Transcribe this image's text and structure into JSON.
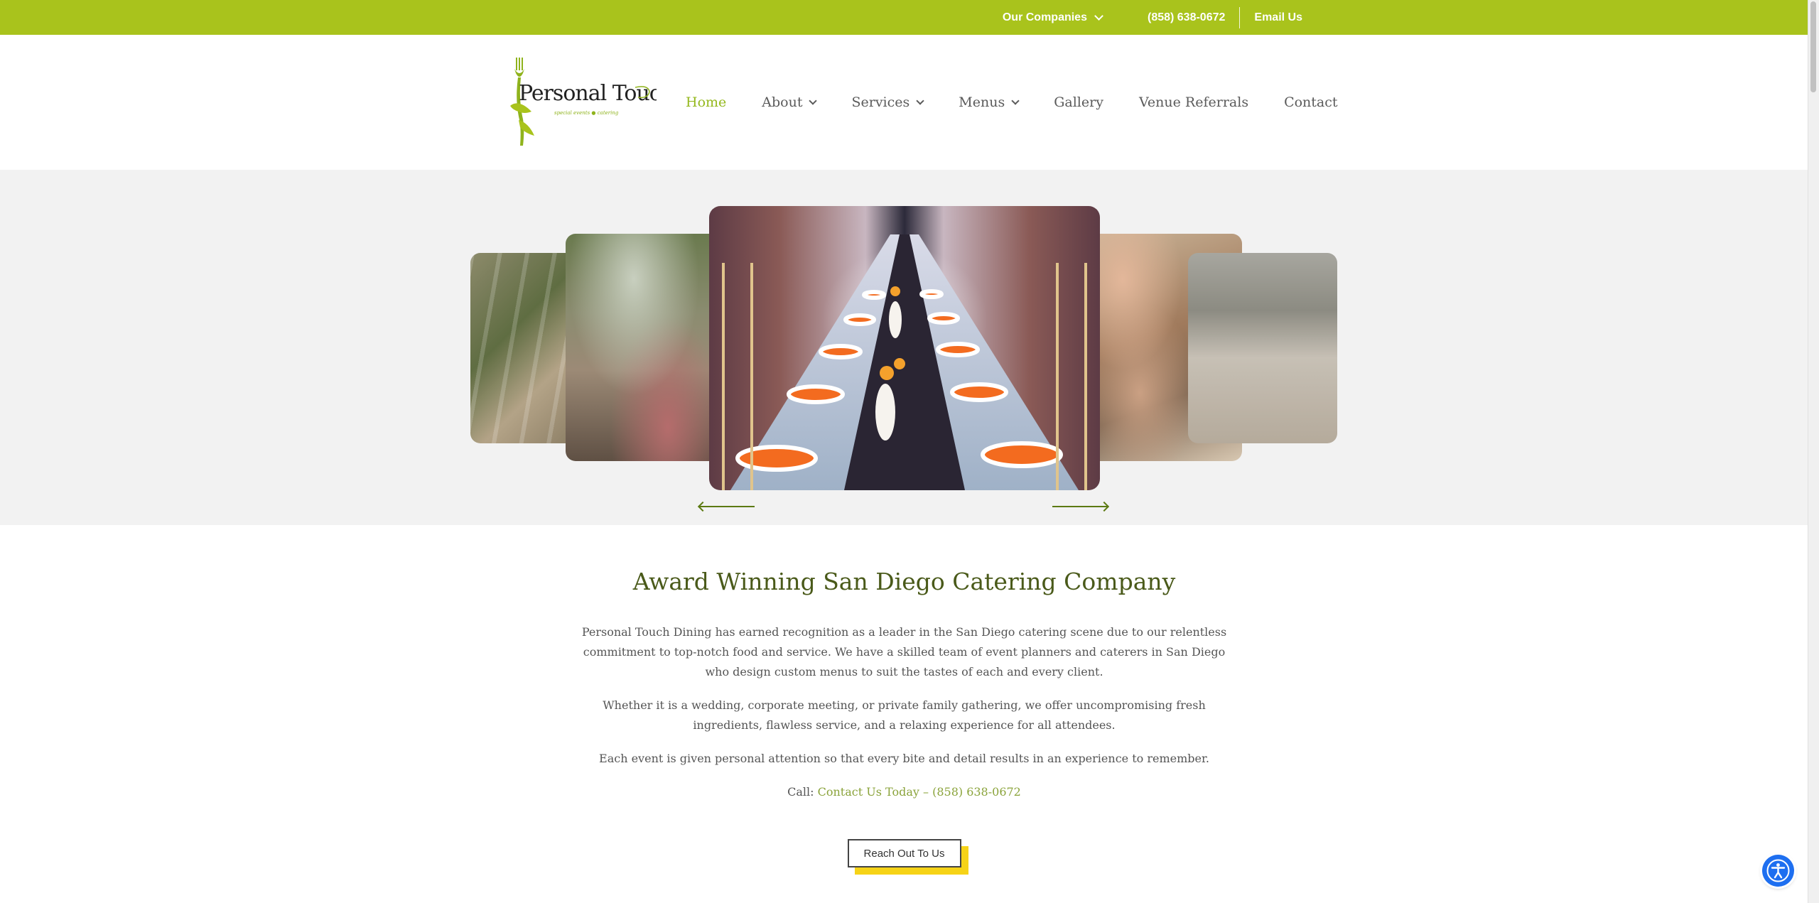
{
  "topbar": {
    "companies_label": "Our Companies",
    "phone": "(858) 638-0672",
    "email_label": "Email Us"
  },
  "header": {
    "logo_text": "Personal Touch dining",
    "logo_tagline": "special events ● catering"
  },
  "nav": {
    "items": [
      {
        "label": "Home"
      },
      {
        "label": "About"
      },
      {
        "label": "Services"
      },
      {
        "label": "Menus"
      },
      {
        "label": "Gallery"
      },
      {
        "label": "Venue Referrals"
      },
      {
        "label": "Contact"
      }
    ]
  },
  "main": {
    "heading": "Award Winning San Diego Catering Company",
    "paragraphs": [
      "Personal Touch Dining has earned recognition as a leader in the San Diego catering scene due to our relentless commitment to top-notch food and service. We have a skilled team of event planners and caterers in San Diego who design custom menus to suit the tastes of each and every client.",
      "Whether it is a wedding, corporate meeting, or private family gathering, we offer uncompromising fresh ingredients, flawless service, and a relaxing experience for all attendees.",
      "Each event is given personal attention so that every bite and detail results in an experience to remember."
    ],
    "call_prefix": "Call: ",
    "call_link": "Contact Us Today – (858) 638-0672",
    "cta_label": "Reach Out To Us"
  },
  "colors": {
    "brand_green": "#a9c31c",
    "heading_green": "#4a5a1a",
    "nav_active": "#94b81d",
    "cta_accent": "#f6d317",
    "a11y_blue": "#1e6ff0"
  }
}
